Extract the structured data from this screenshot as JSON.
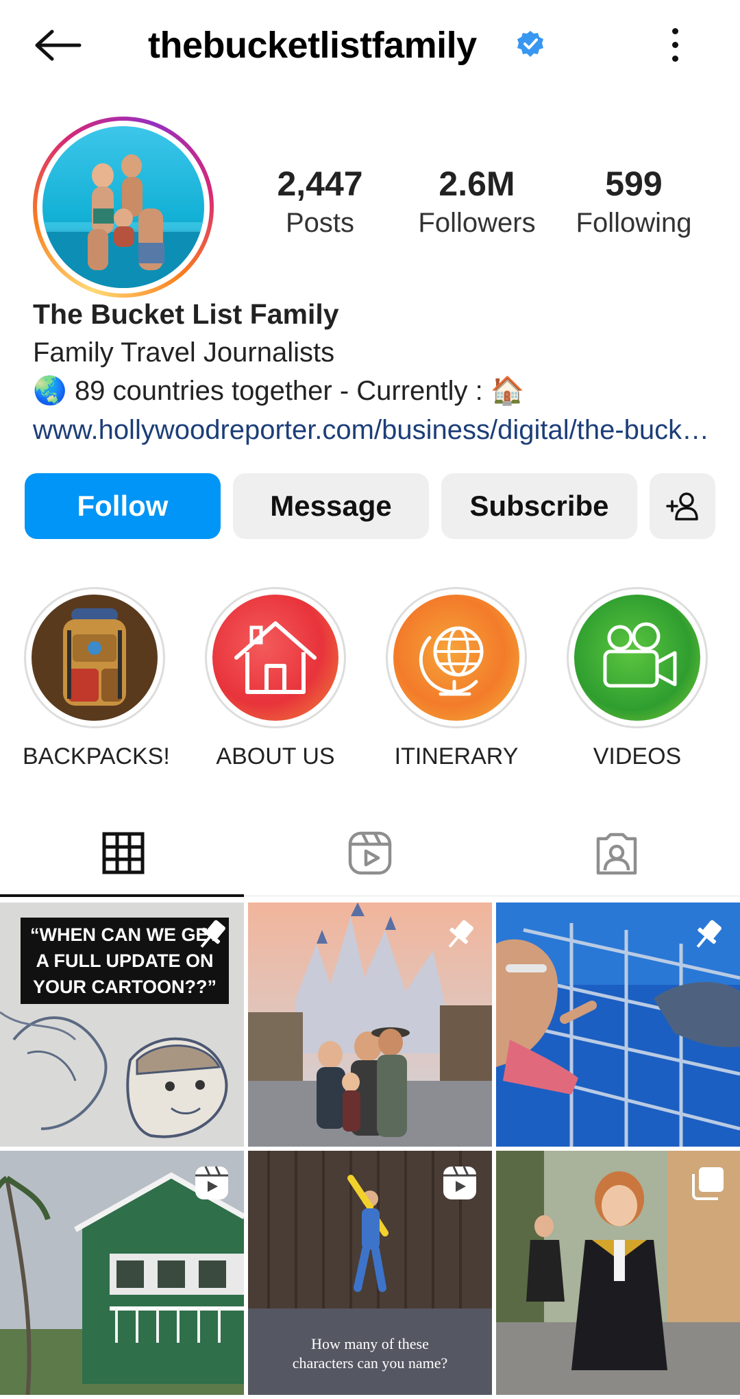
{
  "header": {
    "username": "thebucketlistfamily",
    "back_icon": "arrow-left-icon",
    "verified_icon": "verified-badge-icon",
    "more_icon": "more-vertical-icon"
  },
  "profile": {
    "stats": [
      {
        "value": "2,447",
        "label": "Posts"
      },
      {
        "value": "2.6M",
        "label": "Followers"
      },
      {
        "value": "599",
        "label": "Following"
      }
    ],
    "name": "The Bucket List Family",
    "category": "Family Travel Journalists",
    "bio_line_text": "89 countries together - Currently :",
    "bio_emoji_1": "🌏",
    "bio_emoji_2": "🏠",
    "link": "www.hollywoodreporter.com/business/digital/the-bucket-list-family"
  },
  "actions": {
    "follow": "Follow",
    "message": "Message",
    "subscribe": "Subscribe",
    "suggest_icon": "add-person-icon"
  },
  "highlights": [
    {
      "label": "BACKPACKS!",
      "icon": "backpack-icon"
    },
    {
      "label": "ABOUT US",
      "icon": "house-icon"
    },
    {
      "label": "ITINERARY",
      "icon": "globe-icon"
    },
    {
      "label": "VIDEOS",
      "icon": "video-camera-icon"
    }
  ],
  "tabs": [
    {
      "name": "posts",
      "icon": "grid-icon",
      "selected": true
    },
    {
      "name": "reels",
      "icon": "reels-icon",
      "selected": false
    },
    {
      "name": "tagged",
      "icon": "tagged-icon",
      "selected": false
    }
  ],
  "posts": [
    {
      "badge": "pin-icon",
      "caption_lines": [
        "“WHEN CAN WE GET",
        "A FULL UPDATE ON",
        "YOUR CARTOON??”"
      ]
    },
    {
      "badge": "pin-icon"
    },
    {
      "badge": "pin-icon"
    },
    {
      "badge": "reels-icon"
    },
    {
      "badge": "reels-icon",
      "caption_lines": [
        "How many of these",
        "characters can you name?"
      ]
    },
    {
      "badge": "carousel-icon"
    }
  ],
  "colors": {
    "accent": "#0095f6",
    "link": "#1c3e78",
    "button_bg": "#efefef",
    "verified": "#3897f0"
  }
}
